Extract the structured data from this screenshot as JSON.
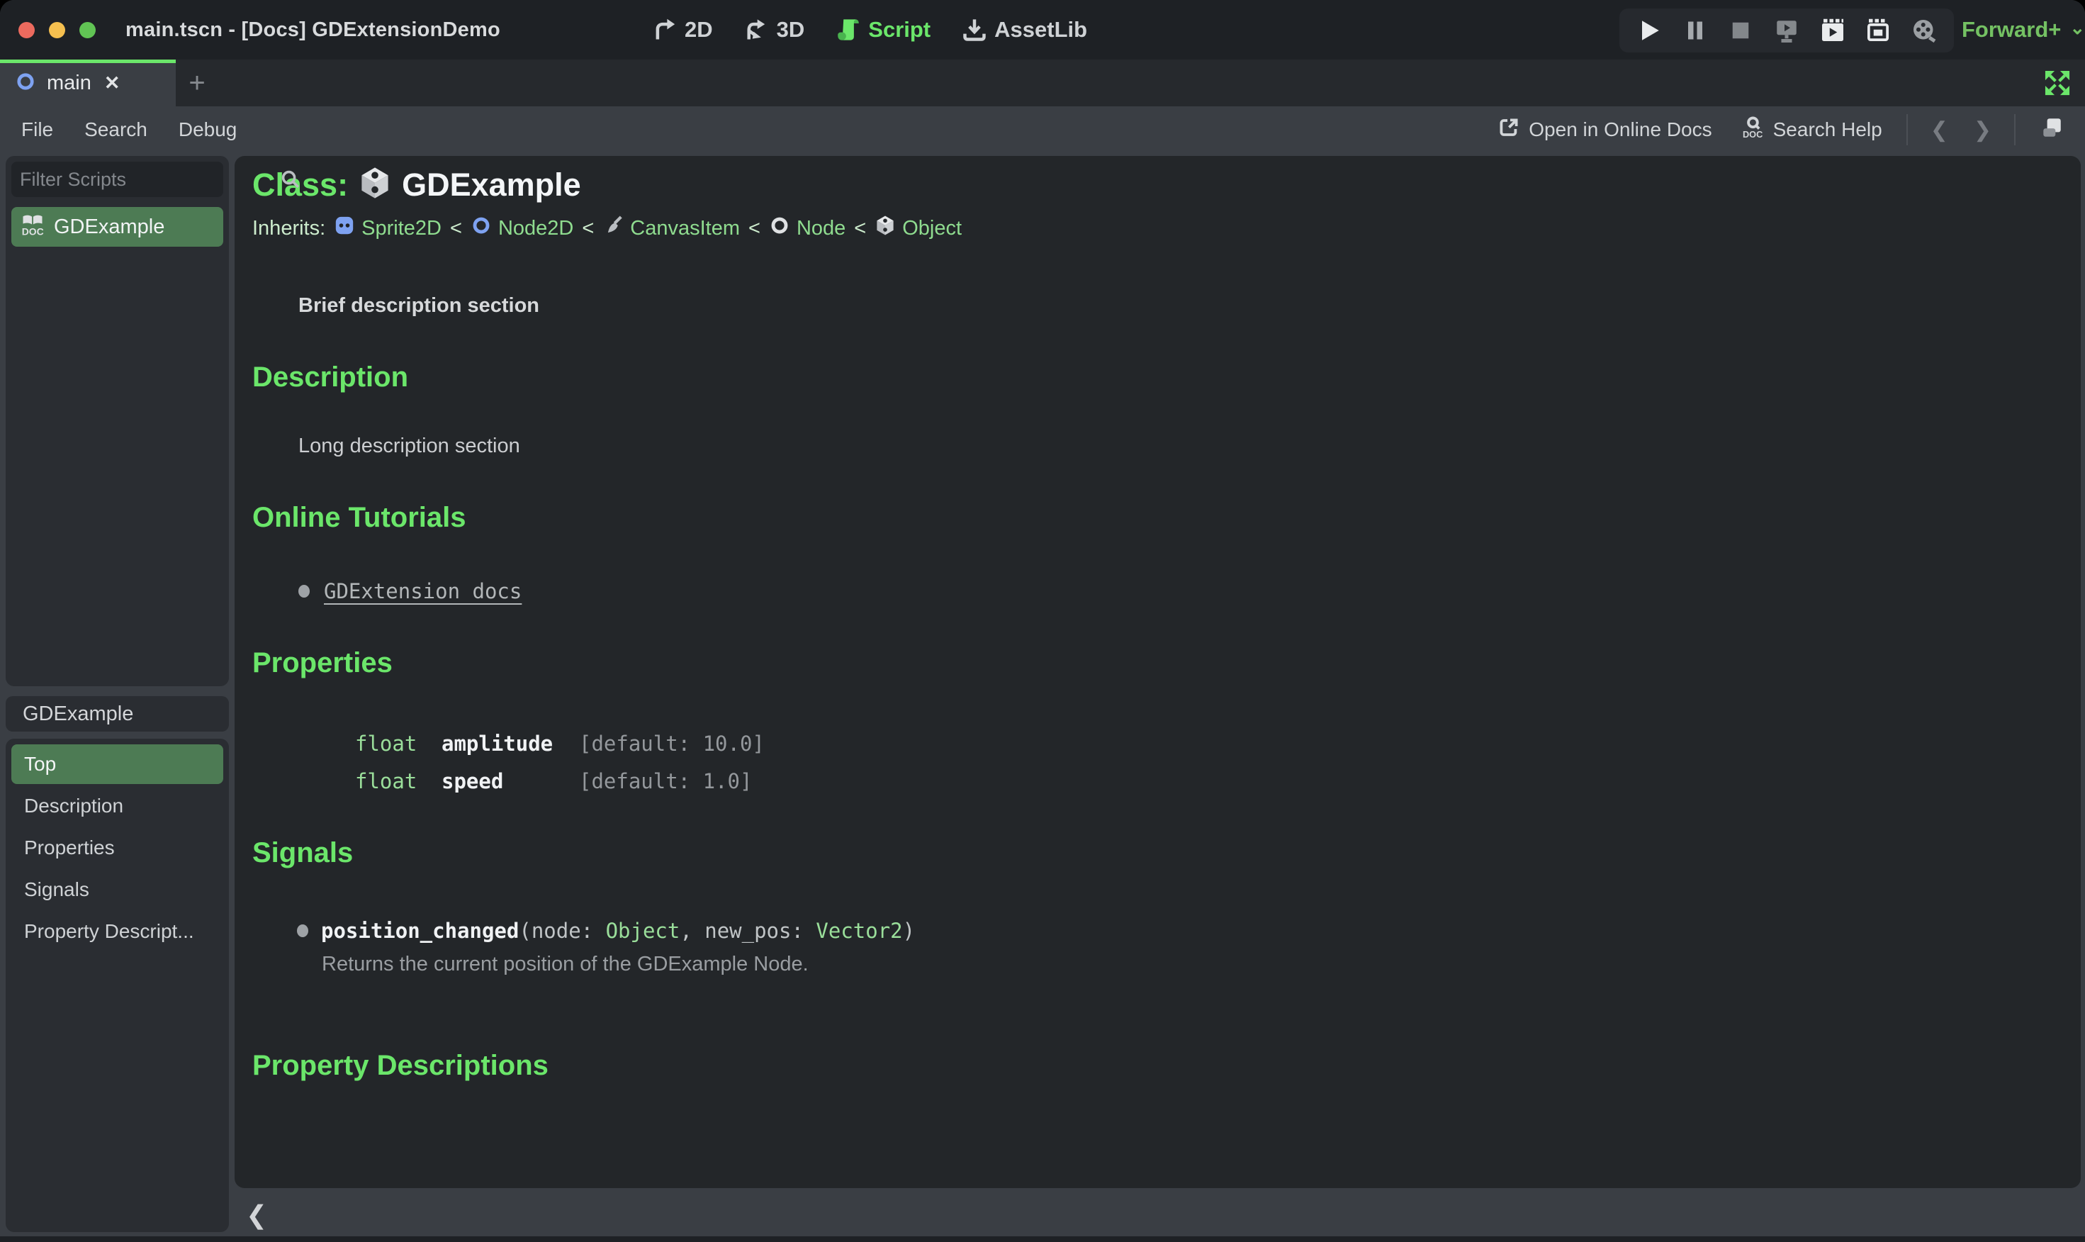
{
  "window": {
    "title": "main.tscn - [Docs] GDExtensionDemo"
  },
  "topbar": {
    "nav": [
      {
        "label": "2D",
        "icon": "2d-icon",
        "active": false
      },
      {
        "label": "3D",
        "icon": "3d-icon",
        "active": false
      },
      {
        "label": "Script",
        "icon": "script-icon",
        "active": true
      },
      {
        "label": "AssetLib",
        "icon": "assetlib-icon",
        "active": false
      }
    ],
    "run_buttons": [
      "play-icon",
      "pause-icon",
      "stop-icon",
      "play-remote-icon",
      "play-scene-icon",
      "play-custom-scene-icon",
      "movie-maker-icon"
    ],
    "renderer": {
      "label": "Forward+",
      "chevron": "⌄"
    }
  },
  "tabs": {
    "active_label": "main",
    "close_glyph": "✕",
    "add_glyph": "+"
  },
  "menus": {
    "left": [
      "File",
      "Search",
      "Debug"
    ],
    "open_online_docs": "Open in Online Docs",
    "search_help": "Search Help",
    "nav_back_glyph": "❮",
    "nav_forward_glyph": "❯"
  },
  "sidebar": {
    "filter_placeholder": "Filter Scripts",
    "scripts": [
      {
        "label": "GDExample",
        "selected": true
      }
    ],
    "class_label": "GDExample",
    "sections": [
      "Top",
      "Description",
      "Properties",
      "Signals",
      "Property Descript..."
    ]
  },
  "doc": {
    "class_label": "Class:",
    "class_name": "GDExample",
    "inherits_label": "Inherits:",
    "separator": "<",
    "inherits_chain": [
      {
        "name": "Sprite2D",
        "icon": "sprite2d-icon"
      },
      {
        "name": "Node2D",
        "icon": "node2d-icon"
      },
      {
        "name": "CanvasItem",
        "icon": "canvasitem-icon"
      },
      {
        "name": "Node",
        "icon": "node-icon"
      },
      {
        "name": "Object",
        "icon": "object-icon"
      }
    ],
    "brief": "Brief description section",
    "description": {
      "heading": "Description",
      "body": "Long description section"
    },
    "tutorials": {
      "heading": "Online Tutorials",
      "link": "GDExtension docs"
    },
    "properties": {
      "heading": "Properties",
      "rows": [
        {
          "type": "float",
          "name": "amplitude",
          "default": "[default: 10.0]"
        },
        {
          "type": "float",
          "name": "speed",
          "default": "[default: 1.0]"
        }
      ]
    },
    "signals": {
      "heading": "Signals",
      "items": [
        {
          "name": "position_changed",
          "args_open": "(node: ",
          "arg1_type": "Object",
          "args_mid": ", new_pos: ",
          "arg2_type": "Vector2",
          "args_close": ")",
          "description": "Returns the current position of the GDExample Node."
        }
      ]
    },
    "property_descriptions": {
      "heading": "Property Descriptions"
    }
  },
  "statusbar": {
    "collapse_glyph": "❮"
  },
  "colors": {
    "accent_green": "#6be66a",
    "selected_green": "#4d7b54",
    "link_green": "#8fdc8f",
    "type_green": "#9ade9a",
    "renderer_green": "#74c163",
    "node_blue": "#7ea2f1",
    "titlebar_bg": "#1e2125",
    "chrome_bg": "#3a3e44",
    "panel_bg": "#232629"
  }
}
